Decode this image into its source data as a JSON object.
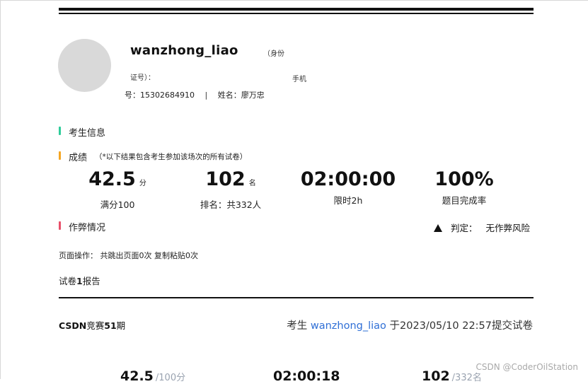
{
  "profile": {
    "username": "wanzhong_liao",
    "id_label_part1": "（身份",
    "id_label_part2": "证号）：",
    "phone_label_part1": "手机",
    "phone_line": "号：15302684910",
    "separator": "|",
    "name_line": "姓名：廖万忠"
  },
  "sections": {
    "candidate_info": "考生信息",
    "score_title": "成绩",
    "score_note": "（*以下结果包含考生参加该场次的所有试卷）",
    "cheating_title": "作弊情况"
  },
  "stats": [
    {
      "value": "42.5",
      "unit": "分",
      "label": "满分100"
    },
    {
      "value": "102",
      "unit": "名",
      "label": "排名：共332人"
    },
    {
      "value": "02:00:00",
      "unit": "",
      "label": "限时2h"
    },
    {
      "value": "100%",
      "unit": "",
      "label": "题目完成率"
    }
  ],
  "verdict": {
    "label": "判定：",
    "value": "无作弊风险"
  },
  "page_ops": "页面操作： 共跳出页面0次 复制粘贴0次",
  "paper_report": {
    "prefix": "试卷",
    "number": "1",
    "suffix": "报告"
  },
  "contest": {
    "prefix": "CSDN",
    "middle": "竞赛",
    "number": "51",
    "suffix": "期"
  },
  "submit": {
    "prefix": "考生 ",
    "username": "wanzhong_liao",
    "suffix": " 于2023/05/10 22:57提交试卷"
  },
  "bottom": {
    "score": "42.5",
    "score_total": "/100分",
    "time": "02:00:18",
    "rank": "102",
    "rank_total": "/332名"
  },
  "watermark": "CSDN @CoderOilStation",
  "colors": {
    "info_bar": "#2ecc9a",
    "score_bar": "#f5a623",
    "cheat_bar": "#e8506a",
    "link": "#2f6fd6"
  },
  "icons": {
    "verdict": "warning-icon"
  }
}
